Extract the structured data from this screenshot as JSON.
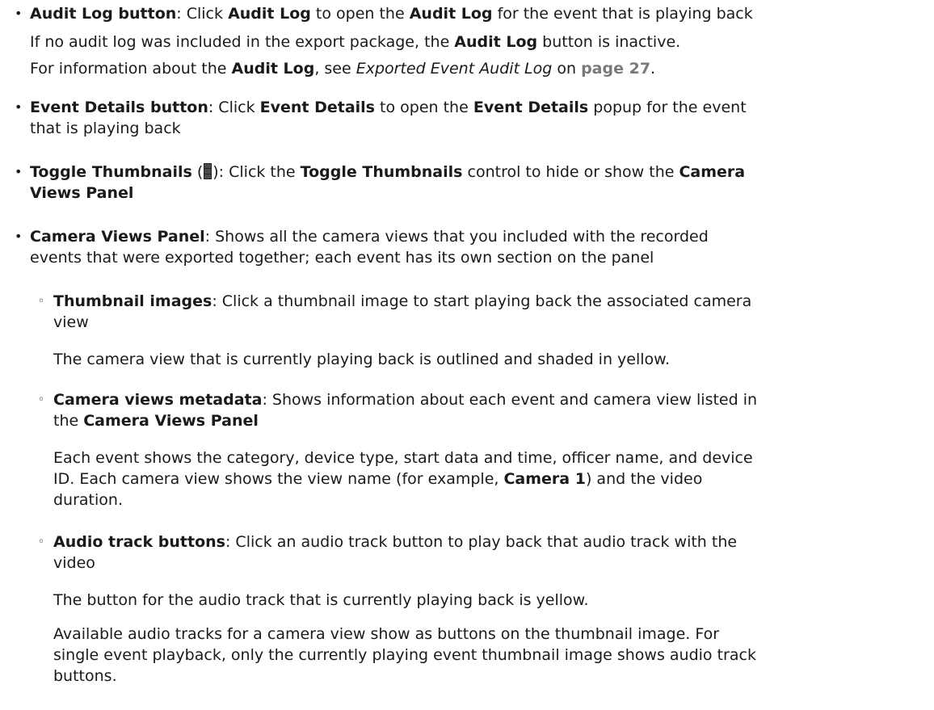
{
  "items": [
    {
      "term": "Audit Log button",
      "sep": ": Click ",
      "b1": "Audit Log",
      "t1": " to open the ",
      "b2": "Audit Log",
      "t2": " for the event that is playing back",
      "p1": {
        "t1": "If no audit log was included in the export package, the ",
        "b1": "Audit Log",
        "t2": " button is inactive."
      },
      "p2": {
        "t1": "For information about the ",
        "b1": "Audit Log",
        "t2": ", see ",
        "i1": "Exported Event Audit Log",
        "t3": " on ",
        "link": "page 27",
        "t4": "."
      }
    },
    {
      "term": "Event Details button",
      "sep": ": Click ",
      "b1": "Event Details",
      "t1": " to open the ",
      "b2": "Event Details",
      "t2": " popup for the event",
      "line2": "that is playing back"
    },
    {
      "term": "Toggle Thumbnails",
      "open": " (",
      "close": "): Click the ",
      "b1": "Toggle Thumbnails",
      "t1": " control to hide or show the ",
      "b2": "Camera",
      "b3": "Views Panel"
    },
    {
      "term": "Camera Views Panel",
      "t1": ": Shows all the camera views that you included with the recorded",
      "line2": "events that were exported together; each event has its own section on the panel"
    }
  ],
  "subitems": [
    {
      "term": "Thumbnail images",
      "t1": ": Click a thumbnail image to start playing back the associated camera",
      "line2": "view",
      "p1": "The camera view that is currently playing back is outlined and shaded in yellow."
    },
    {
      "term": "Camera views metadata",
      "t1": ": Shows information about each event and camera view listed in",
      "line2_pre": "the ",
      "line2_b": "Camera Views Panel",
      "p1_l1": "Each event shows the category, device type, start data and time, officer name, and device",
      "p1_l2_pre": "ID. Each camera view shows the view name (for example, ",
      "p1_l2_b": "Camera 1",
      "p1_l2_post": ") and the video",
      "p1_l3": "duration."
    },
    {
      "term": "Audio track buttons",
      "t1": ": Click an audio track button to play back that audio track with the",
      "line2": "video",
      "p1": "The button for the audio track that is currently playing back is yellow.",
      "p2_l1": "Available audio tracks for a camera view show as buttons on the thumbnail image. For",
      "p2_l2": "single event playback, only the currently playing event thumbnail image shows audio track",
      "p2_l3": "buttons."
    }
  ],
  "icons": {
    "bullet": "•",
    "sub_bullet": "◦",
    "toggle_thumbnails": "toggle-thumbnails-icon"
  }
}
